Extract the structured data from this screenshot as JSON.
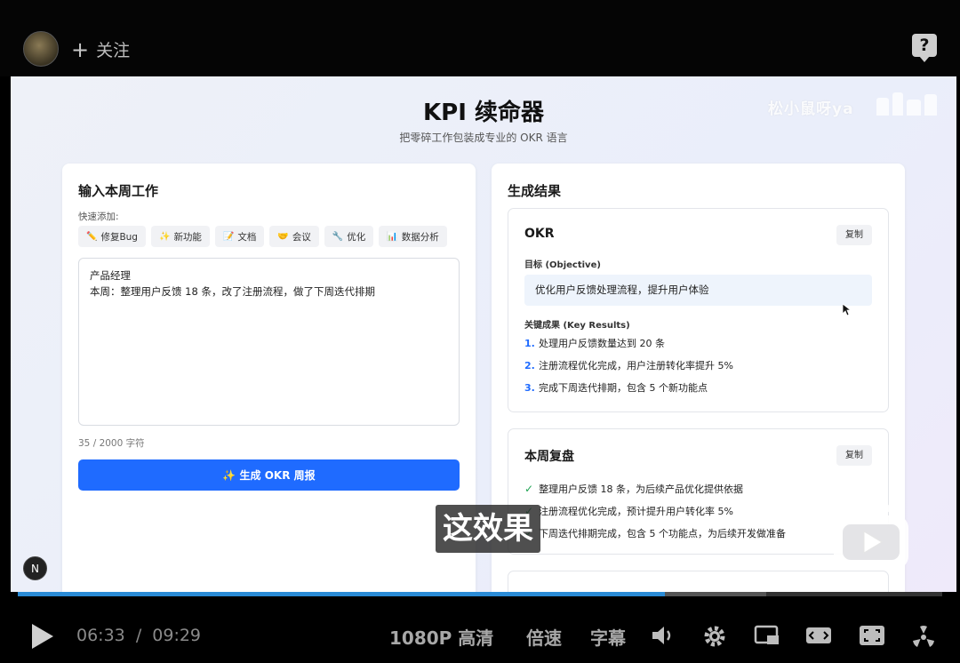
{
  "top": {
    "follow_label": "关注",
    "follow_plus": "+",
    "help_glyph": "?"
  },
  "app": {
    "title": "KPI 续命器",
    "subtitle": "把零碎工作包装成专业的 OKR 语言",
    "watermark": "松小鼠呀ya"
  },
  "input_panel": {
    "title": "输入本周工作",
    "quick_label": "快速添加:",
    "chips": [
      {
        "icon": "✏️",
        "label": "修复Bug"
      },
      {
        "icon": "✨",
        "label": "新功能"
      },
      {
        "icon": "📝",
        "label": "文档"
      },
      {
        "icon": "🤝",
        "label": "会议"
      },
      {
        "icon": "🔧",
        "label": "优化"
      },
      {
        "icon": "📊",
        "label": "数据分析"
      }
    ],
    "textarea_value": "产品经理\n本周：整理用户反馈 18 条，改了注册流程，做了下周迭代排期",
    "counter": "35 / 2000 字符",
    "generate_button": "✨ 生成 OKR 周报"
  },
  "result_panel": {
    "title": "生成结果",
    "okr": {
      "title": "OKR",
      "copy": "复制",
      "objective_label": "目标 (Objective)",
      "objective": "优化用户反馈处理流程，提升用户体验",
      "kr_label": "关键成果 (Key Results)",
      "key_results": [
        {
          "num": "1.",
          "text": "处理用户反馈数量达到 20 条"
        },
        {
          "num": "2.",
          "text": "注册流程优化完成，用户注册转化率提升 5%"
        },
        {
          "num": "3.",
          "text": "完成下周迭代排期，包含 5 个新功能点"
        }
      ]
    },
    "review": {
      "title": "本周复盘",
      "copy": "复制",
      "items": [
        "整理用户反馈 18 条，为后续产品优化提供依据",
        "注册流程优化完成，预计提升用户转化率 5%",
        "下周迭代排期完成，包含 5 个功能点，为后续开发做准备"
      ]
    }
  },
  "overlay": {
    "subtitle": "这效果",
    "n_badge": "N"
  },
  "player": {
    "progress": 0.7,
    "current_time": "06:33",
    "separator": "/",
    "duration": "09:29",
    "quality": "1080P 高清",
    "speed": "倍速",
    "captions": "字幕"
  },
  "colors": {
    "accent": "#1f6bff",
    "check": "#1ea352",
    "progress": "#2a8bd6"
  }
}
